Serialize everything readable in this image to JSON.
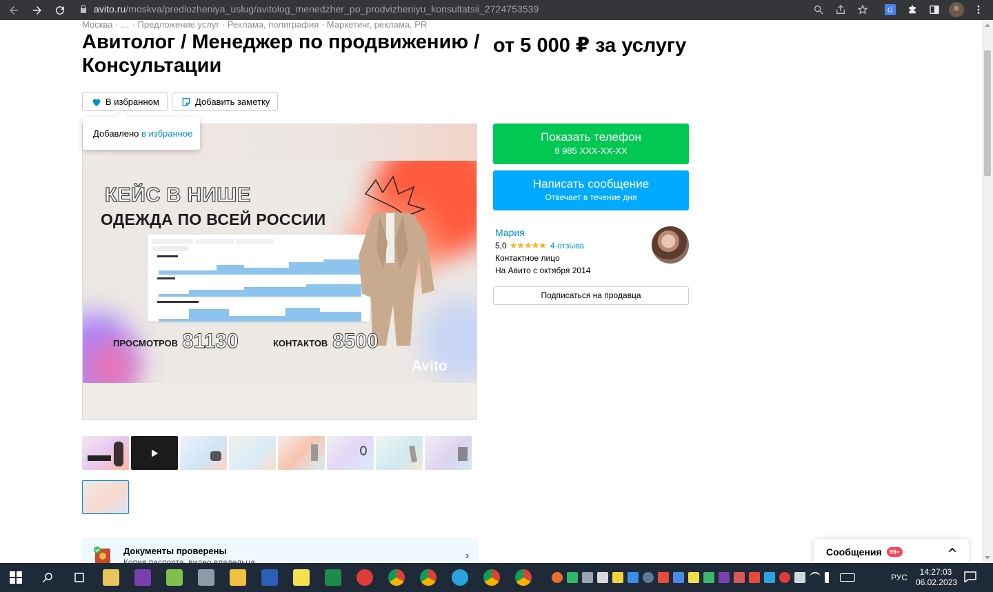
{
  "browser": {
    "url_host": "avito.ru",
    "url_path": "/moskva/predlozheniya_uslug/avitolog_menedzher_po_prodvizheniyu_konsultatsii_2724753539"
  },
  "breadcrumbs": "Москва · … · Предложение услуг · Реклама, полиграфия · Маркетинг, реклама, PR",
  "listing": {
    "title": "Авитолог / Менеджер по продвижению / Консультации",
    "price": "от 5 000 ₽ за услугу"
  },
  "actions": {
    "favorite_label": "В избранном",
    "note_label": "Добавить заметку"
  },
  "tooltip": {
    "text": "Добавлено ",
    "link": "в избранное"
  },
  "slide": {
    "line1": "КЕЙС В НИШЕ",
    "line2": "ОДЕЖДА ПО ВСЕЙ РОССИИ",
    "views_label": "ПРОСМОТРОВ",
    "views_value": "81130",
    "contacts_label": "КОНТАКТОВ",
    "contacts_value": "8500",
    "watermark": "Avito"
  },
  "thumbs_count": 9,
  "docs": {
    "title": "Документы проверены",
    "subtitle": "Копия паспорта, видео владельца"
  },
  "contact": {
    "phone_label": "Показать телефон",
    "phone_masked": "8 985 XXX-XX-XX",
    "message_label": "Написать сообщение",
    "message_sub": "Отвечает в течение дня"
  },
  "seller": {
    "name": "Мария",
    "rating": "5,0",
    "stars": "★★★★★",
    "reviews": "4 отзыва",
    "type": "Контактное лицо",
    "since": "На Авито с октября 2014",
    "subscribe_label": "Подписаться на продавца"
  },
  "messages": {
    "label": "Сообщения",
    "badge": "99+"
  },
  "taskbar": {
    "lang": "РУС",
    "time": "14:27:03",
    "date": "06.02.2023"
  },
  "colors": {
    "green": "#00c853",
    "blue": "#00aaff",
    "link": "#0091d4",
    "badge": "#ff4053"
  }
}
